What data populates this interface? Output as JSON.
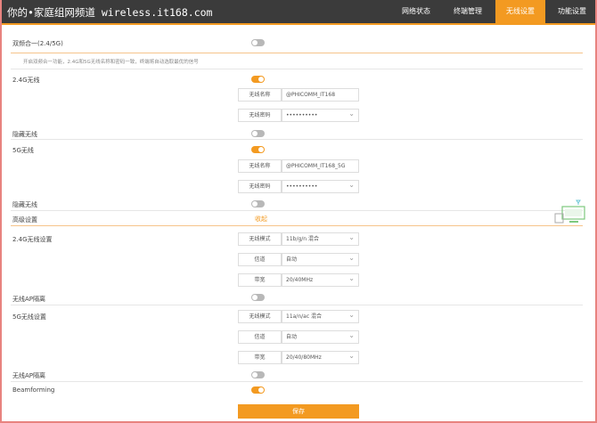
{
  "header": {
    "brand": "你的•家庭组网频道 wireless.it168.com",
    "tabs": [
      {
        "label": "网络状态",
        "active": false
      },
      {
        "label": "终端管理",
        "active": false
      },
      {
        "label": "无线设置",
        "active": true
      },
      {
        "label": "功能设置",
        "active": false
      }
    ]
  },
  "dual_band": {
    "label": "双频合一(2.4/5G)",
    "enabled": false,
    "hint": "开启双频合一功能，2.4G和5G无线名称和密码一致，终端将自动选取最优的信号"
  },
  "wifi24": {
    "label": "2.4G无线",
    "enabled": true,
    "ssid_label": "无线名称",
    "ssid": "@PHICOMM_IT168",
    "pwd_label": "无线密码",
    "pwd": "••••••••••"
  },
  "hide24": {
    "label": "隐藏无线",
    "enabled": false
  },
  "wifi5": {
    "label": "5G无线",
    "enabled": true,
    "ssid_label": "无线名称",
    "ssid": "@PHICOMM_IT168_5G",
    "pwd_label": "无线密码",
    "pwd": "••••••••••"
  },
  "hide5": {
    "label": "隐藏无线",
    "enabled": false
  },
  "advanced": {
    "label": "高级设置",
    "toggle": "收起"
  },
  "adv24": {
    "label": "2.4G无线设置",
    "mode_label": "无线模式",
    "mode": "11b/g/n 混合",
    "channel_label": "信道",
    "channel": "自动",
    "width_label": "带宽",
    "width": "20/40MHz"
  },
  "ap_isolate24": {
    "label": "无线AP隔离",
    "enabled": false
  },
  "adv5": {
    "label": "5G无线设置",
    "mode_label": "无线模式",
    "mode": "11a/n/ac 混合",
    "channel_label": "信道",
    "channel": "自动",
    "width_label": "带宽",
    "width": "20/40/80MHz"
  },
  "ap_isolate5": {
    "label": "无线AP隔离",
    "enabled": false
  },
  "beamforming": {
    "label": "Beamforming",
    "enabled": true
  },
  "save_label": "保存",
  "colors": {
    "accent": "#f39a21",
    "topbar": "#3b3b3b",
    "frame": "#e8837f"
  }
}
